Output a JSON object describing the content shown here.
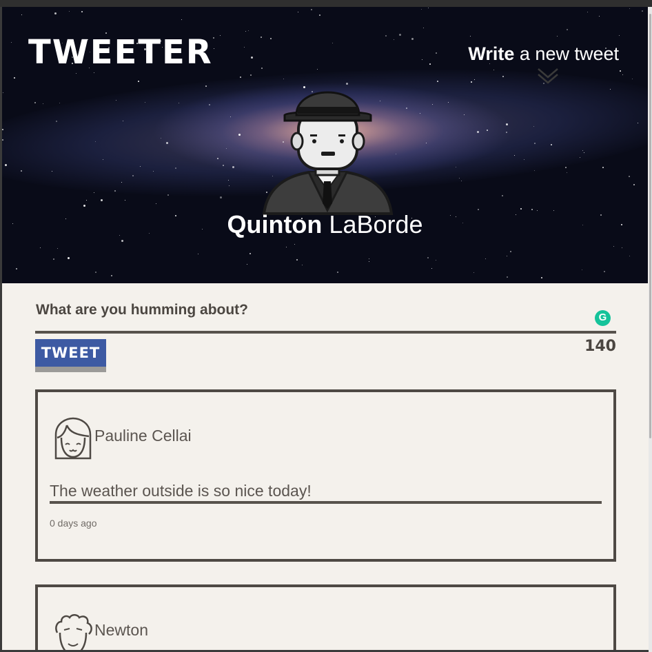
{
  "header": {
    "logo": "TWEETER",
    "compose_link_strong": "Write",
    "compose_link_rest": " a new tweet",
    "user_first_name": "Quinton",
    "user_last_name": "LaBorde"
  },
  "compose": {
    "prompt": "What are you humming about?",
    "button_label": "TWEET",
    "counter": "140",
    "grammarly_glyph": "G"
  },
  "tweets": [
    {
      "author": "Pauline Cellai",
      "text": "The weather outside is so nice today!",
      "time": "0 days ago",
      "avatar": "girl-avatar-icon"
    },
    {
      "author": "Newton",
      "avatar": "curly-hair-avatar-icon"
    }
  ],
  "colors": {
    "button": "#3d5aa3",
    "text": "#4b4641",
    "background": "#f4f1ec",
    "grammarly": "#15c39a"
  }
}
